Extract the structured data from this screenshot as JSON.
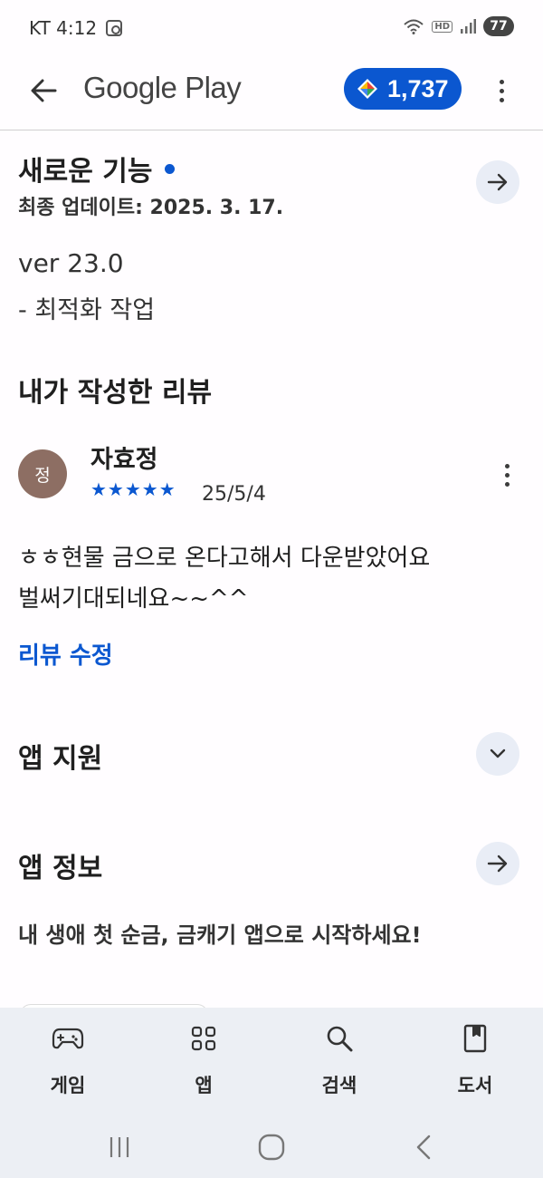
{
  "status_bar": {
    "carrier_time": "KT 4:12",
    "battery": "77",
    "hd": "HD"
  },
  "app_bar": {
    "title": "Google Play",
    "points": "1,737"
  },
  "whats_new": {
    "title": "새로운 기능",
    "updated": "최종 업데이트: 2025. 3. 17.",
    "version": "ver 23.0",
    "note": "- 최적화 작업"
  },
  "my_review": {
    "title": "내가 작성한 리뷰",
    "avatar_letter": "정",
    "author": "자효정",
    "stars": "★★★★★",
    "rating": 5,
    "date": "25/5/4",
    "body_line1": "ㅎㅎ현물 금으로 온다고해서 다운받았어요",
    "body_line2": "벌써기대되네요~~^^",
    "edit_label": "리뷰 수정"
  },
  "app_support": {
    "title": "앱 지원"
  },
  "app_info": {
    "title": "앱 정보",
    "description": "내 생애 첫 순금, 금캐기 앱으로 시작하세요!"
  },
  "bottom_nav": [
    {
      "label": "게임",
      "icon": "gamepad-icon"
    },
    {
      "label": "앱",
      "icon": "apps-grid-icon"
    },
    {
      "label": "검색",
      "icon": "search-icon"
    },
    {
      "label": "도서",
      "icon": "book-icon"
    }
  ],
  "colors": {
    "accent": "#0b57d0",
    "avatar": "#8d6e63",
    "nav_bg": "#eceff4"
  }
}
